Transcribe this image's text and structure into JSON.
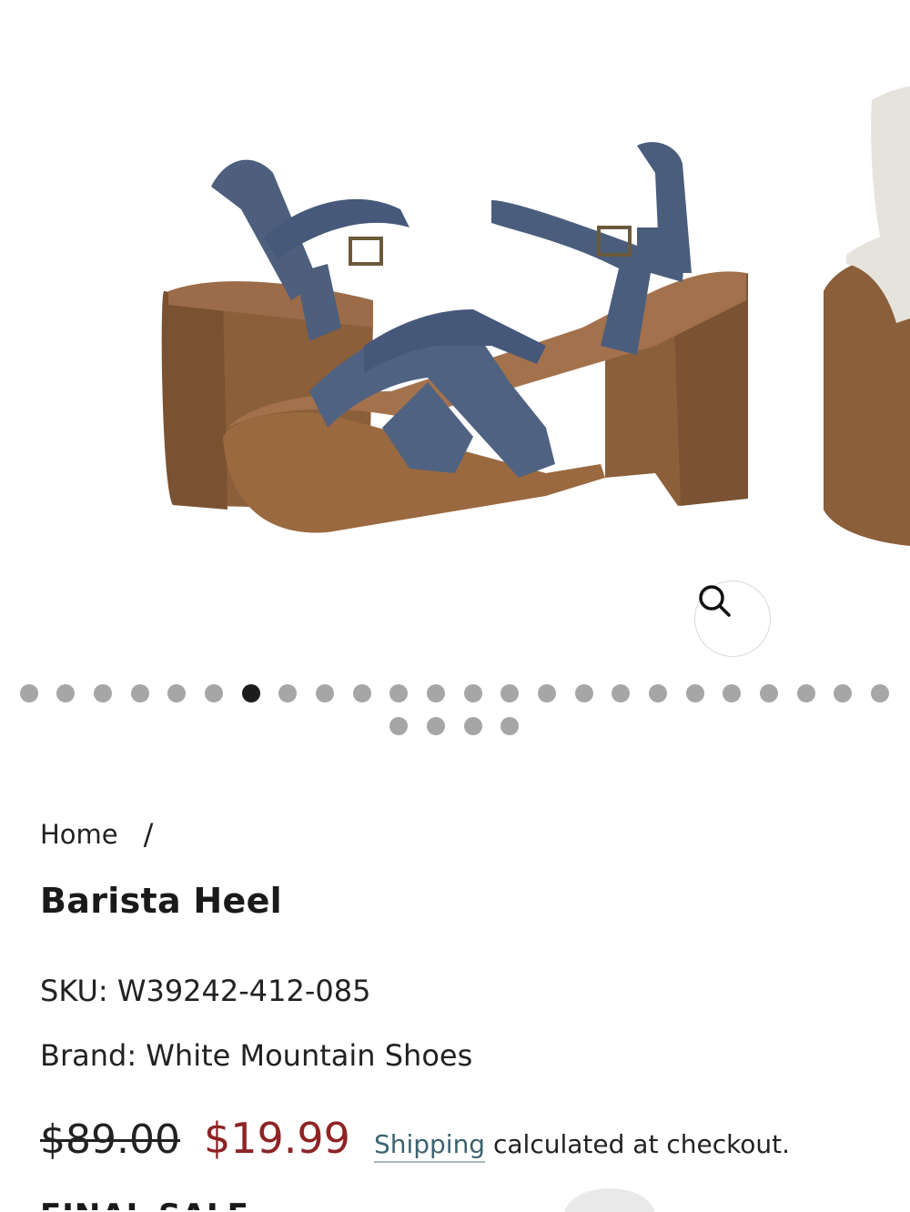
{
  "gallery": {
    "image_alt": "Barista Heel sandal",
    "zoom_icon": "search-icon",
    "dot_count": 28,
    "active_dot_index": 6
  },
  "breadcrumb": {
    "home": "Home",
    "separator": "/"
  },
  "product": {
    "title": "Barista Heel",
    "sku": "SKU: W39242-412-085",
    "brand": "Brand: White Mountain Shoes",
    "compare_price": "$89.00",
    "sale_price": "$19.99",
    "shipping_link": "Shipping",
    "shipping_note": " calculated at checkout.",
    "badge": "FINAL SALE"
  },
  "colors": {
    "sale_price": "#8e2424",
    "link": "#3d6370",
    "dot_active": "#1c1c1c",
    "dot_inactive": "#a6a6a6"
  }
}
